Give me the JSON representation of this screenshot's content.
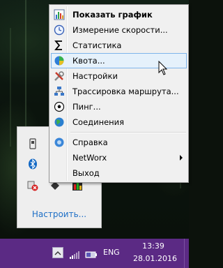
{
  "menu": {
    "items": [
      {
        "label": "Показать график",
        "icon": "chart-icon",
        "bold": true
      },
      {
        "label": "Измерение скорости...",
        "icon": "clock-icon"
      },
      {
        "label": "Статистика",
        "icon": "sigma-icon"
      },
      {
        "label": "Квота...",
        "icon": "pie-icon",
        "highlighted": true
      },
      {
        "label": "Настройки",
        "icon": "tools-icon"
      },
      {
        "label": "Трассировка маршрута...",
        "icon": "network-icon"
      },
      {
        "label": "Пинг...",
        "icon": "ball-icon"
      },
      {
        "label": "Соединения",
        "icon": "globe-icon"
      },
      {
        "label": "Справка",
        "icon": "help-icon"
      },
      {
        "label": "NetWorx",
        "icon": "",
        "submenu": true
      },
      {
        "label": "Выход",
        "icon": ""
      }
    ]
  },
  "tray_flyout": {
    "configure_label": "Настроить..."
  },
  "taskbar": {
    "language": "ENG",
    "time": "13:39",
    "date": "28.01.2016"
  },
  "colors": {
    "taskbar": "#5b2a84",
    "menu_highlight": "#e5f1fb",
    "menu_highlight_border": "#7eb4ea",
    "link": "#1e6fc6"
  }
}
